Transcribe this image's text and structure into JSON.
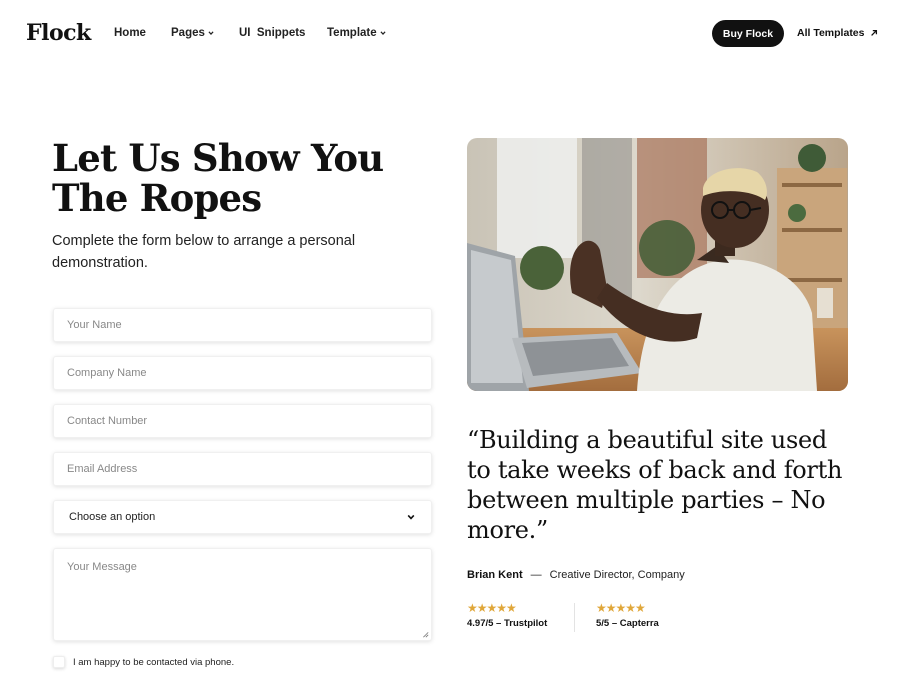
{
  "nav": {
    "logo": "Flock",
    "links": [
      {
        "label": "Home",
        "dropdown": false
      },
      {
        "label": "Pages",
        "dropdown": true
      },
      {
        "label": "UI  Snippets",
        "dropdown": false
      },
      {
        "label": "Template",
        "dropdown": true
      }
    ],
    "buy_label": "Buy Flock",
    "all_templates_label": "All Templates"
  },
  "hero": {
    "headline_line1": "Let Us Show You",
    "headline_line2": "The Ropes",
    "subtitle": "Complete the form below to arrange a personal demonstration."
  },
  "form": {
    "name_placeholder": "Your Name",
    "company_placeholder": "Company Name",
    "contact_placeholder": "Contact Number",
    "email_placeholder": "Email Address",
    "select_value": "Choose an option",
    "message_placeholder": "Your Message",
    "consent_label": "I am happy to be contacted via phone."
  },
  "testimonial": {
    "quote": "“Building a beautiful site used to take weeks of back and forth between multiple parties – No more.”",
    "author_name": "Brian Kent",
    "author_separator": "—",
    "author_role": "Creative Director, Company",
    "ratings": [
      {
        "stars": "★★★★★",
        "label": "4.97/5 – Trustpilot"
      },
      {
        "stars": "★★★★★",
        "label": "5/5 – Capterra"
      }
    ]
  },
  "colors": {
    "accent": "#111111",
    "star": "#e0a73a"
  }
}
